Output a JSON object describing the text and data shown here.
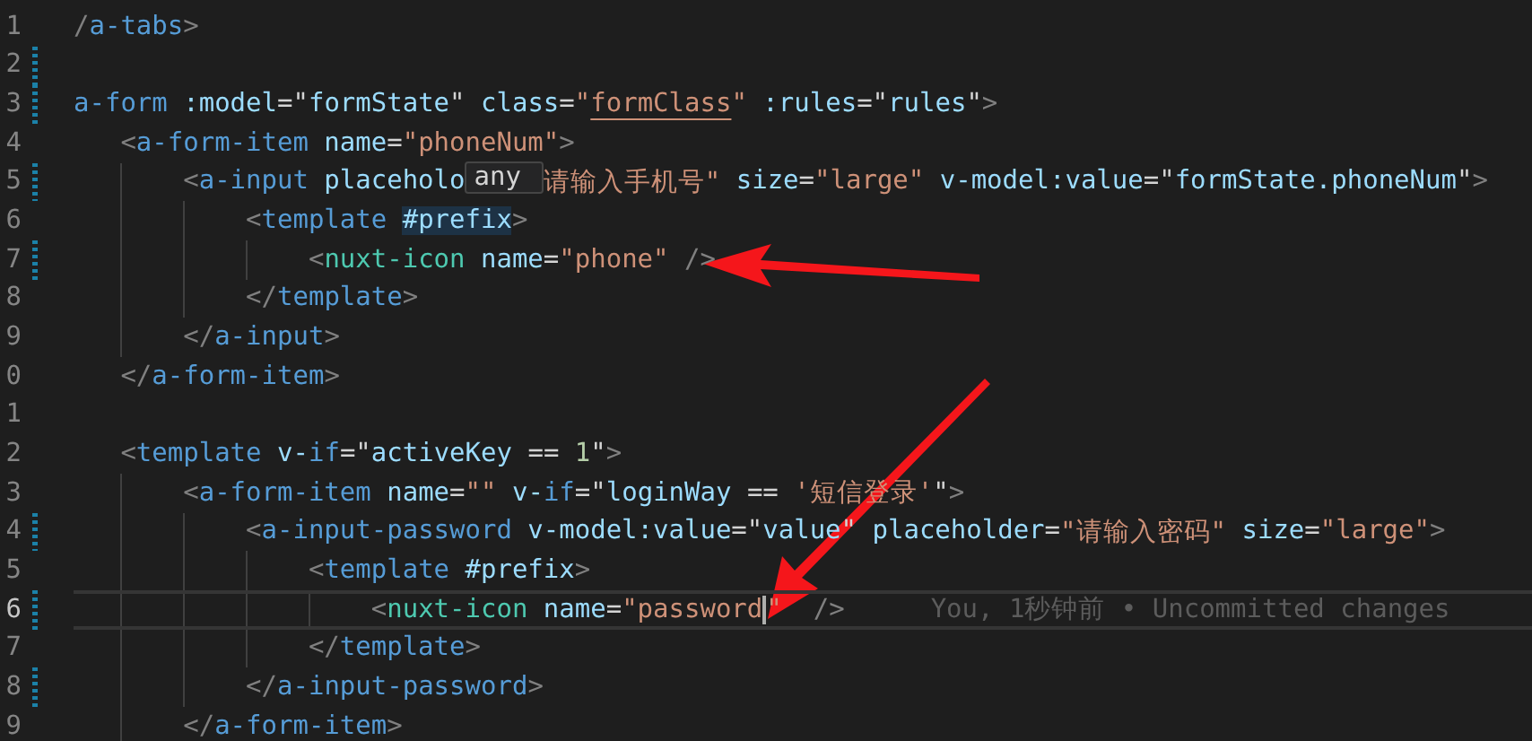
{
  "editor": {
    "lines": [
      {
        "number": "1",
        "changed": false,
        "current": false,
        "tokens": [
          {
            "kind": "punct",
            "text": "/"
          },
          {
            "kind": "tag",
            "text": "a-tabs"
          },
          {
            "kind": "punct",
            "text": ">"
          }
        ]
      },
      {
        "number": "2",
        "changed": true,
        "current": false
      },
      {
        "number": "3",
        "changed": true,
        "current": false,
        "tokens": [
          {
            "kind": "tag",
            "text": "a-form"
          },
          {
            "kind": "attr",
            "text": " :model"
          },
          {
            "kind": "plain",
            "text": "=\""
          },
          {
            "kind": "var",
            "text": "formState"
          },
          {
            "kind": "plain",
            "text": "\" "
          },
          {
            "kind": "attr",
            "text": "class"
          },
          {
            "kind": "plain",
            "text": "="
          },
          {
            "kind": "string",
            "text": "\""
          },
          {
            "kind": "link",
            "text": "formClass"
          },
          {
            "kind": "string",
            "text": "\""
          },
          {
            "kind": "attr",
            "text": " :rules"
          },
          {
            "kind": "plain",
            "text": "=\""
          },
          {
            "kind": "var",
            "text": "rules"
          },
          {
            "kind": "plain",
            "text": "\""
          },
          {
            "kind": "punct",
            "text": ">"
          }
        ]
      },
      {
        "number": "4",
        "changed": false,
        "current": false,
        "tokens": [
          {
            "kind": "punct",
            "text": "   <"
          },
          {
            "kind": "tag",
            "text": "a-form-item"
          },
          {
            "kind": "attr",
            "text": " name"
          },
          {
            "kind": "plain",
            "text": "="
          },
          {
            "kind": "string",
            "text": "\"phoneNum\""
          },
          {
            "kind": "punct",
            "text": ">"
          }
        ]
      },
      {
        "number": "5",
        "changed": true,
        "current": false,
        "tokens": [
          {
            "kind": "punct",
            "text": "       <"
          },
          {
            "kind": "tag",
            "text": "a-input"
          },
          {
            "kind": "attr",
            "text": " placeholo"
          },
          {
            "kind": "tooltip",
            "text": "any"
          },
          {
            "kind": "string",
            "text": "请输入手机号\""
          },
          {
            "kind": "attr",
            "text": " size"
          },
          {
            "kind": "plain",
            "text": "="
          },
          {
            "kind": "string",
            "text": "\"large\""
          },
          {
            "kind": "attr",
            "text": " v-model:value"
          },
          {
            "kind": "plain",
            "text": "=\""
          },
          {
            "kind": "var",
            "text": "formState.phoneNum"
          },
          {
            "kind": "plain",
            "text": "\""
          },
          {
            "kind": "punct",
            "text": ">"
          }
        ]
      },
      {
        "number": "6",
        "changed": false,
        "current": false,
        "tokens": [
          {
            "kind": "punct",
            "text": "           <"
          },
          {
            "kind": "tag",
            "text": "template "
          },
          {
            "kind": "match",
            "text": "#prefix"
          },
          {
            "kind": "punct",
            "text": ">"
          }
        ]
      },
      {
        "number": "7",
        "changed": true,
        "current": false,
        "tokens": [
          {
            "kind": "punct",
            "text": "               <"
          },
          {
            "kind": "component",
            "text": "nuxt-icon"
          },
          {
            "kind": "attr",
            "text": " name"
          },
          {
            "kind": "plain",
            "text": "="
          },
          {
            "kind": "string",
            "text": "\"phone\""
          },
          {
            "kind": "punct",
            "text": " />"
          }
        ]
      },
      {
        "number": "8",
        "changed": false,
        "current": false,
        "tokens": [
          {
            "kind": "punct",
            "text": "           </"
          },
          {
            "kind": "tag",
            "text": "template"
          },
          {
            "kind": "punct",
            "text": ">"
          }
        ]
      },
      {
        "number": "9",
        "changed": false,
        "current": false,
        "tokens": [
          {
            "kind": "punct",
            "text": "       </"
          },
          {
            "kind": "tag",
            "text": "a-input"
          },
          {
            "kind": "punct",
            "text": ">"
          }
        ]
      },
      {
        "number": "0",
        "changed": false,
        "current": false,
        "tokens": [
          {
            "kind": "punct",
            "text": "   </"
          },
          {
            "kind": "tag",
            "text": "a-form-item"
          },
          {
            "kind": "punct",
            "text": ">"
          }
        ]
      },
      {
        "number": "1",
        "changed": false,
        "current": false
      },
      {
        "number": "2",
        "changed": false,
        "current": false,
        "tokens": [
          {
            "kind": "punct",
            "text": "   <"
          },
          {
            "kind": "tag",
            "text": "template"
          },
          {
            "kind": "attr",
            "text": " v-"
          },
          {
            "kind": "keyword",
            "text": "if"
          },
          {
            "kind": "plain",
            "text": "=\""
          },
          {
            "kind": "var",
            "text": "activeKey"
          },
          {
            "kind": "plain",
            "text": " == "
          },
          {
            "kind": "number",
            "text": "1"
          },
          {
            "kind": "plain",
            "text": "\""
          },
          {
            "kind": "punct",
            "text": ">"
          }
        ]
      },
      {
        "number": "3",
        "changed": false,
        "current": false,
        "tokens": [
          {
            "kind": "punct",
            "text": "       <"
          },
          {
            "kind": "tag",
            "text": "a-form-item"
          },
          {
            "kind": "attr",
            "text": " name"
          },
          {
            "kind": "plain",
            "text": "="
          },
          {
            "kind": "string",
            "text": "\"\""
          },
          {
            "kind": "attr",
            "text": " v-"
          },
          {
            "kind": "keyword",
            "text": "if"
          },
          {
            "kind": "plain",
            "text": "=\""
          },
          {
            "kind": "var",
            "text": "loginWay"
          },
          {
            "kind": "plain",
            "text": " == "
          },
          {
            "kind": "string",
            "text": "'短信登录'"
          },
          {
            "kind": "plain",
            "text": "\""
          },
          {
            "kind": "punct",
            "text": ">"
          }
        ]
      },
      {
        "number": "4",
        "changed": true,
        "current": false,
        "tokens": [
          {
            "kind": "punct",
            "text": "           <"
          },
          {
            "kind": "tag",
            "text": "a-input-password"
          },
          {
            "kind": "attr",
            "text": " v-model:value"
          },
          {
            "kind": "plain",
            "text": "=\""
          },
          {
            "kind": "var",
            "text": "value"
          },
          {
            "kind": "plain",
            "text": "\""
          },
          {
            "kind": "attr",
            "text": " placeholder"
          },
          {
            "kind": "plain",
            "text": "="
          },
          {
            "kind": "string",
            "text": "\"请输入密码\""
          },
          {
            "kind": "attr",
            "text": " size"
          },
          {
            "kind": "plain",
            "text": "="
          },
          {
            "kind": "string",
            "text": "\"large\""
          },
          {
            "kind": "punct",
            "text": ">"
          }
        ]
      },
      {
        "number": "5",
        "changed": false,
        "current": false,
        "tokens": [
          {
            "kind": "punct",
            "text": "               <"
          },
          {
            "kind": "tag",
            "text": "template"
          },
          {
            "kind": "attr",
            "text": " #prefix"
          },
          {
            "kind": "punct",
            "text": ">"
          }
        ]
      },
      {
        "number": "6",
        "changed": true,
        "current": true,
        "blame": "You, 1秒钟前 • Uncommitted changes",
        "tokens": [
          {
            "kind": "punct",
            "text": "                   <"
          },
          {
            "kind": "component",
            "text": "nuxt-icon"
          },
          {
            "kind": "attr",
            "text": " name"
          },
          {
            "kind": "plain",
            "text": "="
          },
          {
            "kind": "caret_string",
            "text": "\"password"
          },
          {
            "kind": "string",
            "text": "\""
          },
          {
            "kind": "punct",
            "text": "  />"
          }
        ]
      },
      {
        "number": "7",
        "changed": false,
        "current": false,
        "tokens": [
          {
            "kind": "punct",
            "text": "               </"
          },
          {
            "kind": "tag",
            "text": "template"
          },
          {
            "kind": "punct",
            "text": ">"
          }
        ]
      },
      {
        "number": "8",
        "changed": true,
        "current": false,
        "tokens": [
          {
            "kind": "punct",
            "text": "           </"
          },
          {
            "kind": "tag",
            "text": "a-input-password"
          },
          {
            "kind": "punct",
            "text": ">"
          }
        ]
      },
      {
        "number": "9",
        "changed": false,
        "current": false,
        "tokens": [
          {
            "kind": "punct",
            "text": "       </"
          },
          {
            "kind": "tag",
            "text": "a-form-item"
          },
          {
            "kind": "punct",
            "text": ">"
          }
        ]
      }
    ]
  }
}
